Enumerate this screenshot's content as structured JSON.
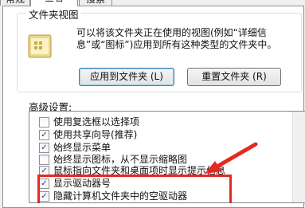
{
  "tabs": [
    "常规",
    "查看",
    "搜索"
  ],
  "folder_views": {
    "title": "文件夹视图",
    "description": "可以将该文件夹正在使用的视图(例如“详细信息”或“图标”)应用到所有这种类型的文件夹中。",
    "apply_button": "应用到文件夹 (L)",
    "reset_button": "重置文件夹 (R)"
  },
  "advanced": {
    "title": "高级设置:",
    "items": [
      {
        "label": "使用复选框以选择项",
        "checked": false
      },
      {
        "label": "使用共享向导(推荐)",
        "checked": true
      },
      {
        "label": "始终显示菜单",
        "checked": true
      },
      {
        "label": "始终显示图标，从不显示缩略图",
        "checked": false
      },
      {
        "label": "鼠标指向文件夹和桌面项时显示提示信息",
        "checked": true
      },
      {
        "label": "显示驱动器号",
        "checked": true
      },
      {
        "label": "隐藏计算机文件夹中的空驱动器",
        "checked": true
      }
    ]
  },
  "colors": {
    "highlight": "#e32a22",
    "arrow": "#e32a22"
  }
}
